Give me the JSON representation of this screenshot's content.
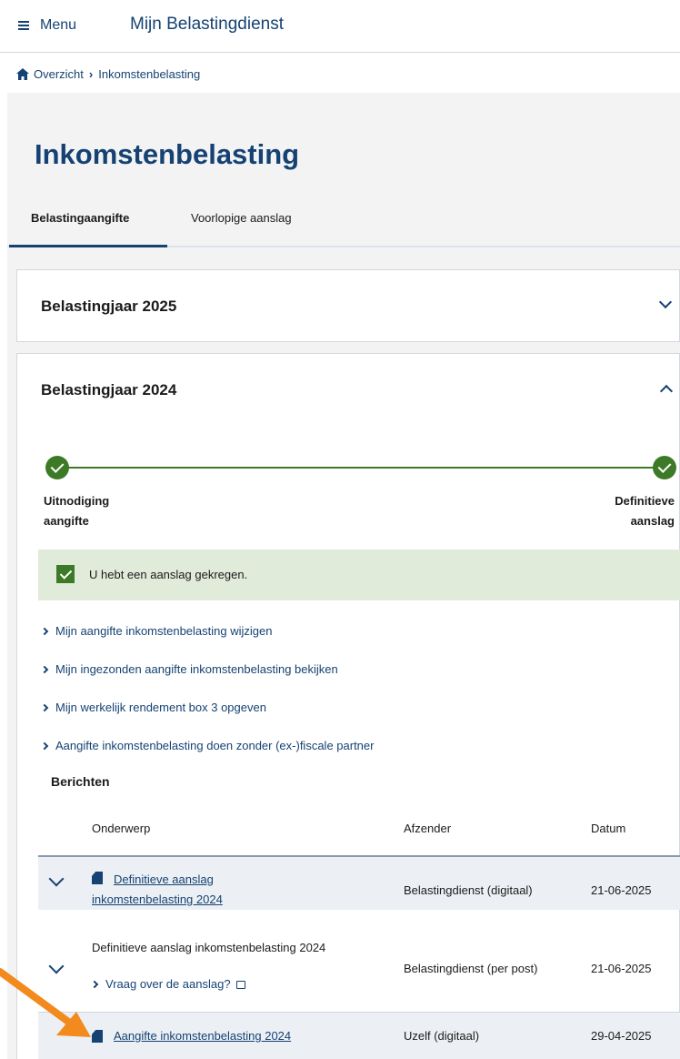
{
  "header": {
    "menu_label": "Menu",
    "app_title": "Mijn Belastingdienst"
  },
  "breadcrumb": {
    "home": "Overzicht",
    "current": "Inkomstenbelasting"
  },
  "page_title": "Inkomstenbelasting",
  "tabs": [
    {
      "label": "Belastingaangifte",
      "active": true
    },
    {
      "label": "Voorlopige aanslag",
      "active": false
    }
  ],
  "accordion": [
    {
      "label": "Belastingjaar 2025",
      "expanded": false
    },
    {
      "label": "Belastingjaar 2024",
      "expanded": true
    }
  ],
  "progress": {
    "steps": [
      {
        "line1": "Uitnodiging",
        "line2": "aangifte",
        "done": true
      },
      {
        "line1": "Definitieve",
        "line2": "aanslag",
        "done": true
      }
    ]
  },
  "notice": "U hebt een aanslag gekregen.",
  "links": [
    "Mijn aangifte inkomstenbelasting wijzigen",
    "Mijn ingezonden aangifte inkomstenbelasting bekijken",
    "Mijn werkelijk rendement box 3 opgeven",
    "Aangifte inkomstenbelasting doen zonder (ex-)fiscale partner"
  ],
  "messages": {
    "title": "Berichten",
    "columns": [
      "Onderwerp",
      "Afzender",
      "Datum"
    ],
    "rows": [
      {
        "subject_line1": "Definitieve aanslag",
        "subject_line2": "inkomstenbelasting 2024",
        "sender": "Belastingdienst (digitaal)",
        "date": "21-06-2025"
      },
      {
        "subject": "Definitieve aanslag inkomstenbelasting 2024",
        "link": "Vraag over de aanslag?",
        "sender": "Belastingdienst (per post)",
        "date": "21-06-2025"
      },
      {
        "subject": "Aangifte inkomstenbelasting 2024",
        "sender": "Uzelf (digitaal)",
        "date": "29-04-2025"
      }
    ]
  },
  "colors": {
    "brand": "#154273",
    "success": "#3d7a28",
    "notice_bg": "#e1ebd9",
    "annotation": "#f28a1e"
  }
}
